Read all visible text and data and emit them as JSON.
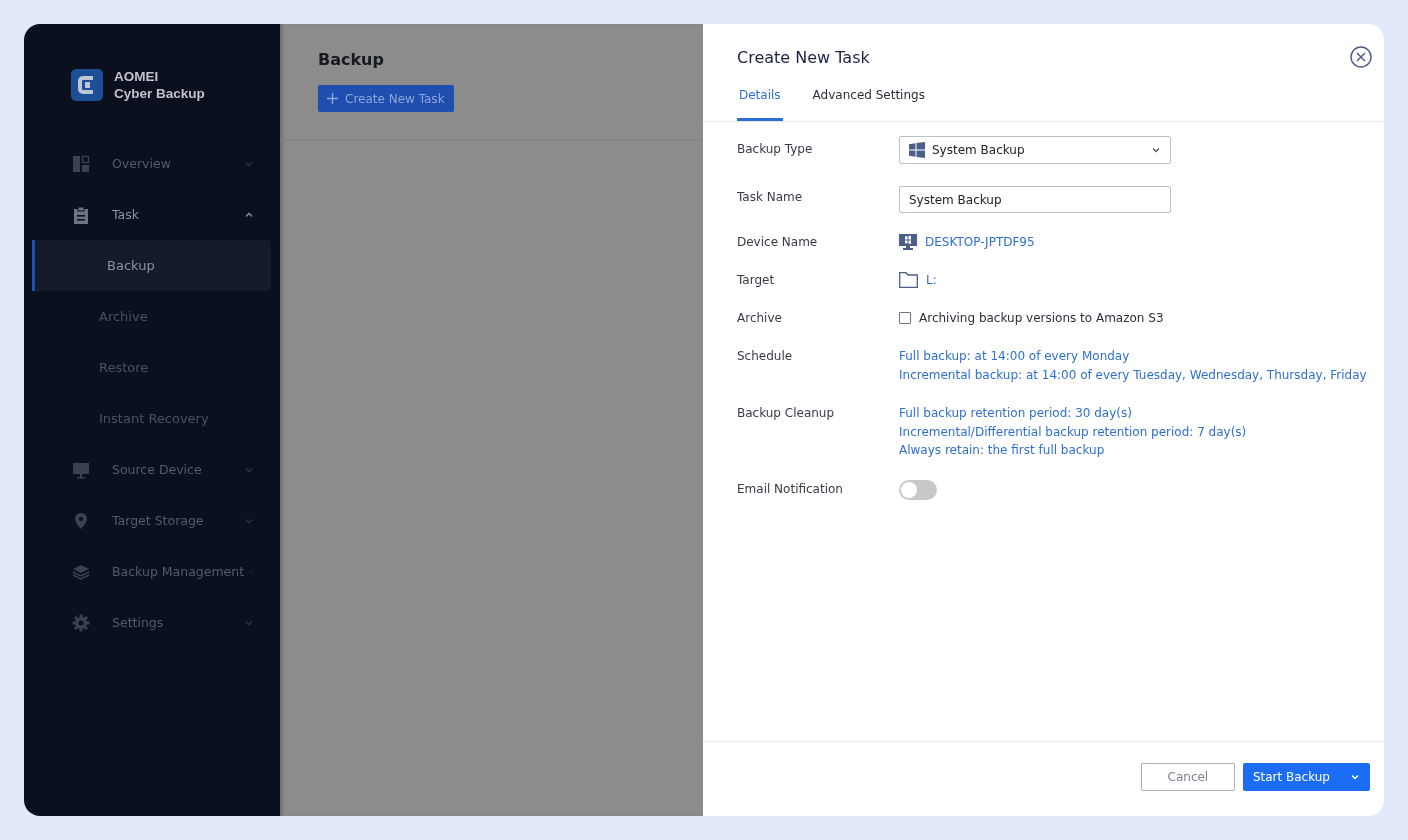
{
  "app": {
    "logo_line1": "AOMEI",
    "logo_line2": "Cyber Backup"
  },
  "sidebar": {
    "items": [
      {
        "label": "Overview",
        "expanded": false
      },
      {
        "label": "Task",
        "expanded": true,
        "children": [
          {
            "label": "Backup",
            "selected": true
          },
          {
            "label": "Archive",
            "selected": false
          },
          {
            "label": "Restore",
            "selected": false
          },
          {
            "label": "Instant Recovery",
            "selected": false
          }
        ]
      },
      {
        "label": "Source Device",
        "expanded": false
      },
      {
        "label": "Target Storage",
        "expanded": false
      },
      {
        "label": "Backup Management",
        "expanded": false
      },
      {
        "label": "Settings",
        "expanded": false
      }
    ]
  },
  "main": {
    "title": "Backup",
    "create_button": "Create New Task"
  },
  "drawer": {
    "title": "Create New Task",
    "tabs": [
      {
        "label": "Details",
        "selected": true
      },
      {
        "label": "Advanced Settings",
        "selected": false
      }
    ],
    "fields": [
      {
        "kind": "select",
        "label": "Backup Type",
        "value": "System Backup"
      },
      {
        "kind": "input",
        "label": "Task Name",
        "value": "System Backup"
      },
      {
        "kind": "device",
        "label": "Device Name",
        "value": "DESKTOP-JPTDF95"
      },
      {
        "kind": "folder",
        "label": "Target",
        "value": "L:"
      },
      {
        "kind": "checkbox",
        "label": "Archive",
        "text": "Archiving backup versions to Amazon S3",
        "checked": false
      },
      {
        "kind": "lines",
        "label": "Schedule",
        "lines": [
          "Full backup: at 14:00 of every Monday",
          "Incremental backup: at 14:00 of every Tuesday, Wednesday, Thursday, Friday"
        ]
      },
      {
        "kind": "lines",
        "label": "Backup Cleanup",
        "lines": [
          "Full backup retention period: 30 day(s)",
          "Incremental/Differential backup retention period: 7 day(s)",
          "Always retain: the first full backup"
        ]
      },
      {
        "kind": "toggle",
        "label": "Email Notification",
        "on": false
      }
    ],
    "cancel_button": "Cancel",
    "start_button": "Start Backup"
  }
}
